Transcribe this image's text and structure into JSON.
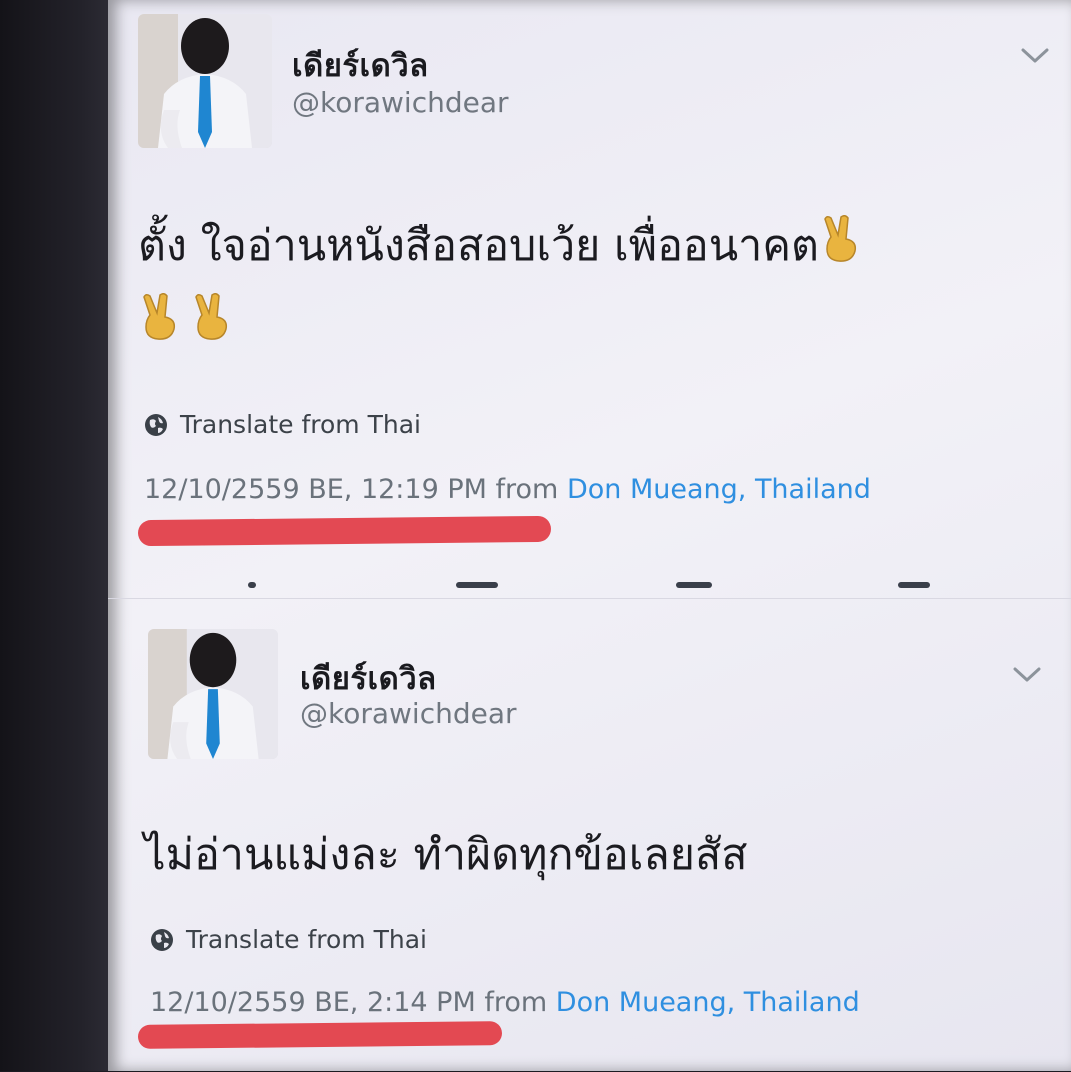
{
  "tweets": [
    {
      "display_name": "เดียร์เดวิล",
      "handle": "@korawichdear",
      "text_line1": "ตั้ง ใจอ่านหนังสือสอบเว้ย เพื่ออนาคต",
      "emoji": "✌",
      "translate_label": "Translate from Thai",
      "timestamp": "12/10/2559 BE, 12:19 PM",
      "from_label": "from",
      "location": "Don Mueang, Thailand"
    },
    {
      "display_name": "เดียร์เดวิล",
      "handle": "@korawichdear",
      "text": "ไม่อ่านแม่งละ ทำผิดทุกข้อเลยสัส",
      "translate_label": "Translate from Thai",
      "timestamp": "12/10/2559 BE, 2:14 PM",
      "from_label": "from",
      "location": "Don Mueang, Thailand"
    }
  ],
  "colors": {
    "accent_link": "#2f8fe0",
    "annotation_red": "#e23b44",
    "tie_blue": "#1f86d1"
  },
  "icons": [
    "avatar",
    "chevron-down-icon",
    "globe-icon",
    "victory-hand-emoji"
  ]
}
